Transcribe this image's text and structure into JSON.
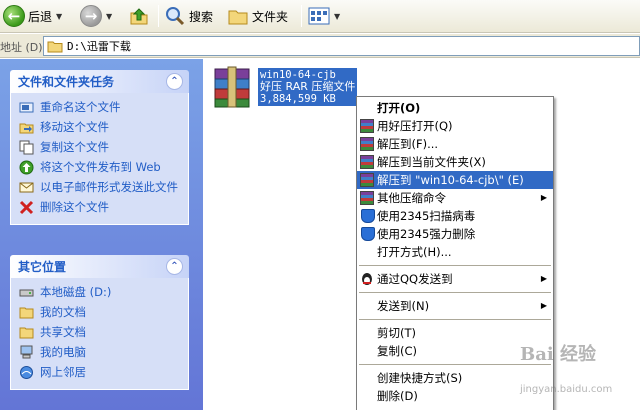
{
  "toolbar": {
    "back_label": "后退",
    "search_label": "搜索",
    "folders_label": "文件夹"
  },
  "address": {
    "label": "地址 (D)",
    "path": "D:\\迅雷下载"
  },
  "tasks_panel": {
    "title": "文件和文件夹任务",
    "items": [
      {
        "label": "重命名这个文件",
        "icon": "rename-icon"
      },
      {
        "label": "移动这个文件",
        "icon": "move-icon"
      },
      {
        "label": "复制这个文件",
        "icon": "copy-icon"
      },
      {
        "label": "将这个文件发布到 Web",
        "icon": "web-publish-icon"
      },
      {
        "label": "以电子邮件形式发送此文件",
        "icon": "email-icon"
      },
      {
        "label": "删除这个文件",
        "icon": "delete-icon"
      }
    ]
  },
  "places_panel": {
    "title": "其它位置",
    "items": [
      {
        "label": "本地磁盘 (D:)",
        "icon": "drive-icon"
      },
      {
        "label": "我的文档",
        "icon": "folder-icon"
      },
      {
        "label": "共享文档",
        "icon": "folder-icon"
      },
      {
        "label": "我的电脑",
        "icon": "computer-icon"
      },
      {
        "label": "网上邻居",
        "icon": "network-icon"
      }
    ]
  },
  "file": {
    "name": "win10-64-cjb",
    "type": "好压 RAR 压缩文件",
    "size": "3,884,599 KB"
  },
  "context_menu": {
    "open": "打开(O)",
    "open_haozip": "用好压打开(Q)",
    "extract_to": "解压到(F)...",
    "extract_here": "解压到当前文件夹(X)",
    "extract_named": "解压到 \"win10-64-cjb\\\" (E)",
    "other_compress": "其他压缩命令",
    "scan_2345": "使用2345扫描病毒",
    "delete_2345": "使用2345强力删除",
    "open_with": "打开方式(H)...",
    "send_qq": "通过QQ发送到",
    "send_to": "发送到(N)",
    "cut": "剪切(T)",
    "copy": "复制(C)",
    "create_shortcut": "创建快捷方式(S)",
    "delete": "删除(D)"
  },
  "watermark": {
    "brand": "Bai 经验",
    "url": "jingyan.baidu.com"
  },
  "colors": {
    "selection": "#316ac5",
    "link": "#215dc6",
    "pane_top": "#7ba2e7",
    "pane_bottom": "#6375d6"
  }
}
